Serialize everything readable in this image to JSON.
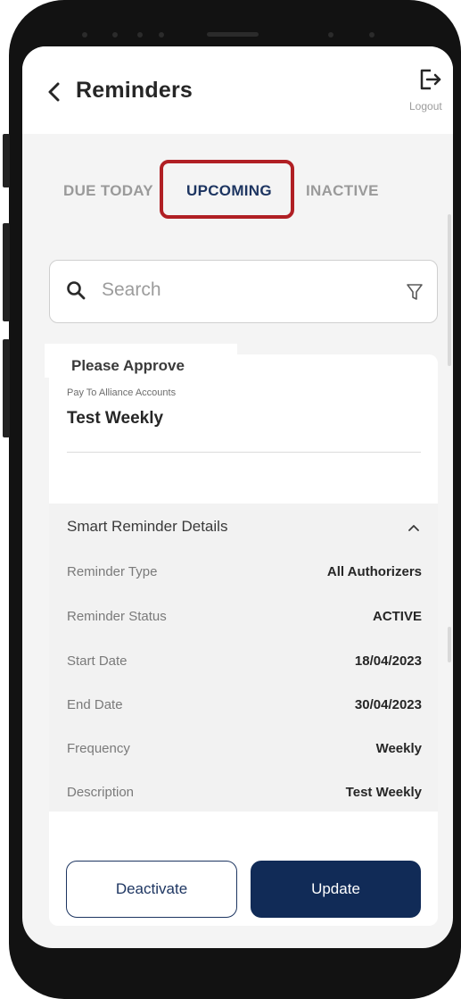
{
  "header": {
    "title": "Reminders",
    "logout_label": "Logout"
  },
  "tabs": [
    {
      "label": "DUE TODAY",
      "active": false
    },
    {
      "label": "UPCOMING",
      "active": true
    },
    {
      "label": "INACTIVE",
      "active": false
    }
  ],
  "search": {
    "placeholder": "Search",
    "value": ""
  },
  "card": {
    "label": "Please Approve",
    "pay_to": "Pay To Alliance Accounts",
    "name": "Test Weekly",
    "details_title": "Smart Reminder Details",
    "rows": [
      {
        "label": "Reminder Type",
        "value": "All Authorizers"
      },
      {
        "label": "Reminder Status",
        "value": "ACTIVE"
      },
      {
        "label": "Start Date",
        "value": "18/04/2023"
      },
      {
        "label": "End Date",
        "value": "30/04/2023"
      },
      {
        "label": "Frequency",
        "value": "Weekly"
      },
      {
        "label": "Description",
        "value": "Test Weekly"
      }
    ]
  },
  "buttons": {
    "deactivate": "Deactivate",
    "update": "Update"
  },
  "colors": {
    "accent": "#112b57",
    "highlight": "#b01f24",
    "tab_active": "#1d3561",
    "tab_inactive": "#9a9a9a"
  },
  "icons": [
    "chevron-left-icon",
    "logout-icon",
    "search-icon",
    "filter-icon",
    "chevron-up-icon"
  ]
}
